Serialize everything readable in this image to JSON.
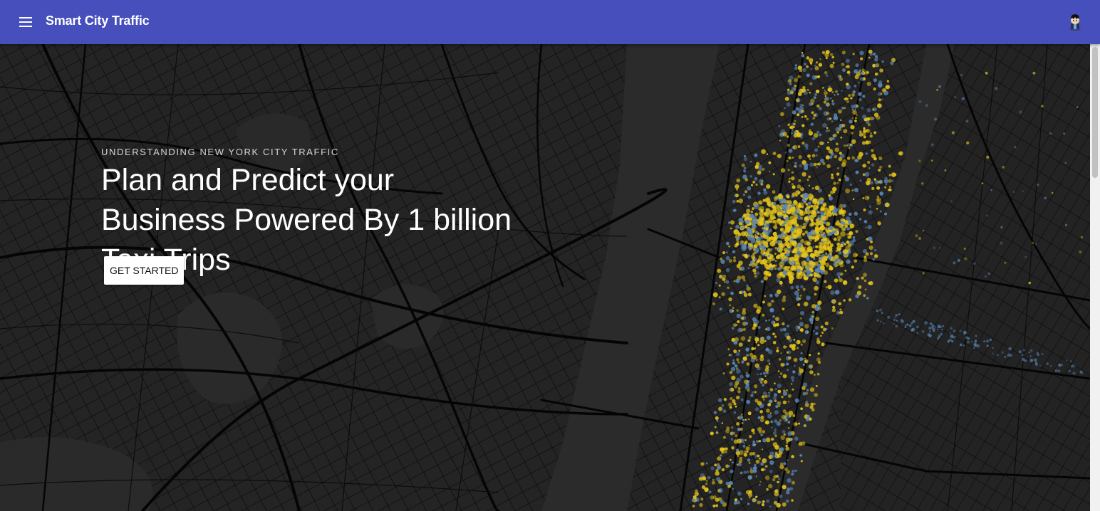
{
  "appbar": {
    "title": "Smart City Traffic",
    "menu_icon": "hamburger-menu-icon",
    "avatar_icon": "user-avatar-icon"
  },
  "hero": {
    "eyebrow": "UNDERSTANDING NEW YORK CITY TRAFFIC",
    "headline_lines": [
      "Plan and Predict your",
      "Business Powered By 1 billion",
      "Taxi Trips"
    ],
    "cta_label": "GET STARTED",
    "background": "dark street map of New York City with taxi trip density points"
  },
  "colors": {
    "appbar": "#464fbc",
    "map_land": "#1c1c1c",
    "map_water": "#2a2a2a",
    "map_roads": "#0a0a0a",
    "trip_yellow": "#e6c619",
    "trip_blue": "#5b86b8"
  }
}
